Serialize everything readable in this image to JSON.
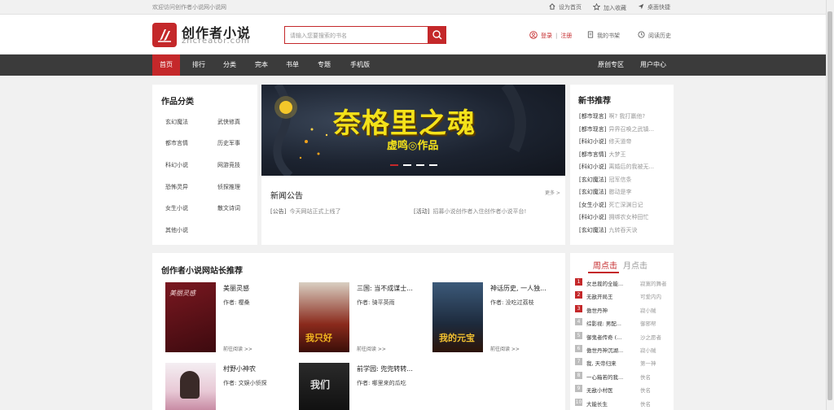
{
  "topbar": {
    "welcome": "欢迎访问创作者小说网小说网",
    "links": [
      "设为首页",
      "加入收藏",
      "桌面快捷"
    ]
  },
  "header": {
    "logo_title": "创作者小说",
    "logo_sub": "zhcreator.com",
    "search_placeholder": "请输入您要搜索的书名",
    "login": "登录",
    "sep": "|",
    "register": "注册",
    "bookshelf": "我的书架",
    "history": "阅读历史"
  },
  "nav": {
    "items": [
      "首页",
      "排行",
      "分类",
      "完本",
      "书单",
      "专题",
      "手机版"
    ],
    "right": [
      "原创专区",
      "用户中心"
    ]
  },
  "categories": {
    "title": "作品分类",
    "items": [
      "玄幻魔法",
      "武侠修真",
      "都市言情",
      "历史军事",
      "科幻小说",
      "网游竞技",
      "恐怖灵异",
      "侦探推理",
      "女生小说",
      "散文诗词",
      "其他小说"
    ]
  },
  "banner": {
    "title": "奈格里之魂",
    "author": "虚鸣◎作品"
  },
  "news": {
    "title": "新闻公告",
    "more": "更多 >",
    "items": [
      {
        "tag": "[公告]",
        "text": "今天网站正式上线了"
      },
      {
        "tag": "[活动]",
        "text": "招募小说创作者入住创作者小说平台!"
      }
    ]
  },
  "new_books": {
    "title": "新书推荐",
    "items": [
      {
        "tag": "[都市现言]",
        "name": "啊? 我打赢他?"
      },
      {
        "tag": "[都市现言]",
        "name": "异界召唤之武镇..."
      },
      {
        "tag": "[科幻小说]",
        "name": "修天道帝"
      },
      {
        "tag": "[都市言情]",
        "name": "大梦王"
      },
      {
        "tag": "[科幻小说]",
        "name": "离婚后的我被无..."
      },
      {
        "tag": "[玄幻魔法]",
        "name": "冠军信条"
      },
      {
        "tag": "[玄幻魔法]",
        "name": "憨动是李"
      },
      {
        "tag": "[女生小说]",
        "name": "死亡深渊日记"
      },
      {
        "tag": "[科幻小说]",
        "name": "拥绑农女种田忙"
      },
      {
        "tag": "[玄幻魔法]",
        "name": "九转吞天诀"
      }
    ]
  },
  "recommend": {
    "title": "创作者小说网站长推荐",
    "author_label": "作者:",
    "read_label": "前往阅读 >>",
    "books": [
      {
        "title": "美丽灵感",
        "author": "樱桑",
        "cover_text": "美丽灵感"
      },
      {
        "title": "三国: 当不成谋士...",
        "author": "骑平英雨",
        "cover_text": "我只好"
      },
      {
        "title": "神话历史, 一人独...",
        "author": "没吃过荔枝",
        "cover_text": "我的元宝"
      },
      {
        "title": "村野小神农",
        "author": "文娱小侦探",
        "cover_text": ""
      },
      {
        "title": "前学园: 兜兜转转...",
        "author": "哪里来的瓜吃",
        "cover_text": "我们"
      }
    ]
  },
  "ranking": {
    "tab_active": "周点击",
    "tab_inactive": "月点击",
    "items": [
      {
        "num": "1",
        "book": "女总裁的全能...",
        "author": "寂寞的舞者"
      },
      {
        "num": "2",
        "book": "无敌开局王",
        "author": "可爱内内"
      },
      {
        "num": "3",
        "book": "傲世丹神",
        "author": "寂小贼"
      },
      {
        "num": "4",
        "book": "综影视: 男配...",
        "author": "御邪帮"
      },
      {
        "num": "5",
        "book": "御鬼者传奇 (...",
        "author": "沙之愿者"
      },
      {
        "num": "6",
        "book": "傲世丹神沉湖...",
        "author": "寂小贼"
      },
      {
        "num": "7",
        "book": "我, 天帝归来",
        "author": "第一神"
      },
      {
        "num": "8",
        "book": "一心箱若的我...",
        "author": "佚名"
      },
      {
        "num": "9",
        "book": "无敌小村医",
        "author": "佚名"
      },
      {
        "num": "10",
        "book": "大能长生",
        "author": "佚名"
      }
    ]
  },
  "colors": {
    "accent": "#c4282a",
    "nav_bg": "#3b3b3b"
  }
}
